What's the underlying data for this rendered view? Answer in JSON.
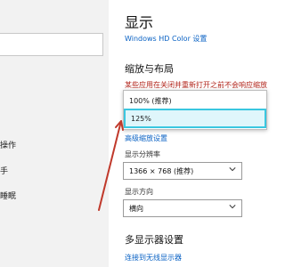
{
  "left_pane": {
    "items": [
      {
        "label": "操作"
      },
      {
        "label": "手"
      },
      {
        "label": "睡眠"
      }
    ]
  },
  "display": {
    "title": "显示",
    "hd_color_link": "Windows HD Color 设置",
    "scale_layout_heading": "缩放与布局",
    "notice": "某些应用在关闭并重新打开之前不会响应缩放更改",
    "scale_options": [
      {
        "label": "100% (推荐)"
      },
      {
        "label": "125%"
      }
    ],
    "advanced_scaling_link": "高级缩放设置",
    "resolution_label": "显示分辨率",
    "resolution_value": "1366 × 768 (推荐)",
    "orientation_label": "显示方向",
    "orientation_value": "横向",
    "multi_display_heading": "多显示器设置",
    "wireless_link": "连接到无线显示器"
  },
  "colors": {
    "accent": "#0a62c4",
    "highlight_border": "#3ac7e0",
    "annotation": "#c0392b"
  }
}
